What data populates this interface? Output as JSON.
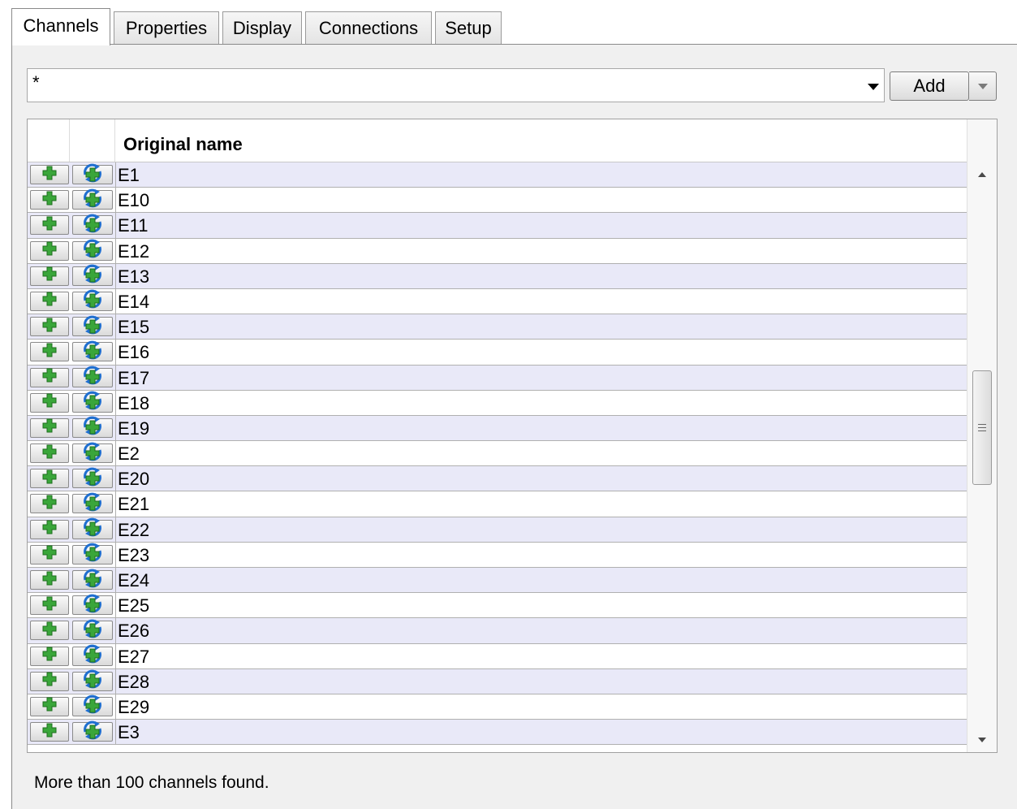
{
  "tabs": [
    {
      "label": "Channels",
      "active": true
    },
    {
      "label": "Properties"
    },
    {
      "label": "Display"
    },
    {
      "label": "Connections"
    },
    {
      "label": "Setup"
    }
  ],
  "filter": {
    "value": "*"
  },
  "add_button": {
    "label": "Add"
  },
  "table": {
    "header": {
      "name": "Original name"
    },
    "rows": [
      "E1",
      "E10",
      "E11",
      "E12",
      "E13",
      "E14",
      "E15",
      "E16",
      "E17",
      "E18",
      "E19",
      "E2",
      "E20",
      "E21",
      "E22",
      "E23",
      "E24",
      "E25",
      "E26",
      "E27",
      "E28",
      "E29",
      "E3"
    ]
  },
  "status": {
    "text": "More than 100 channels found."
  },
  "icons": {
    "add_row": "green-plus-icon",
    "add_all": "refresh-plus-icon"
  },
  "colors": {
    "alt_row": "#e9e9f8",
    "plus_green": "#3aa63a",
    "refresh_blue": "#1f6fd0"
  }
}
